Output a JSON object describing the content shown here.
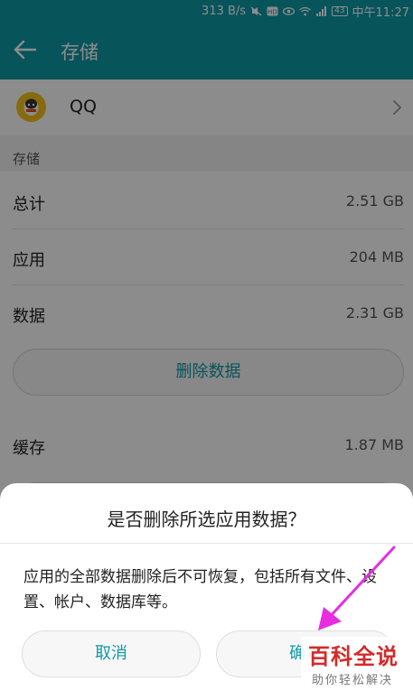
{
  "status_bar": {
    "speed": "313 B/s",
    "battery": "43",
    "time": "中午11:27"
  },
  "app_bar": {
    "title": "存储"
  },
  "app_row": {
    "name": "QQ"
  },
  "storage": {
    "section_label": "存储",
    "rows": [
      {
        "label": "总计",
        "value": "2.51 GB"
      },
      {
        "label": "应用",
        "value": "204 MB"
      },
      {
        "label": "数据",
        "value": "2.31 GB"
      }
    ],
    "clear_data_label": "删除数据",
    "cache": {
      "label": "缓存",
      "value": "1.87 MB"
    }
  },
  "dialog": {
    "title": "是否删除所选应用数据？",
    "message": "应用的全部数据删除后不可恢复，包括所有文件、设置、帐户、数据库等。",
    "cancel_label": "取消",
    "confirm_label": "确定"
  },
  "watermark": {
    "main": "百科全说",
    "sub": "助你轻松解决"
  },
  "colors": {
    "accent": "#0e9aa7",
    "arrow": "#e62ee0",
    "watermark": "#d42a2a"
  }
}
